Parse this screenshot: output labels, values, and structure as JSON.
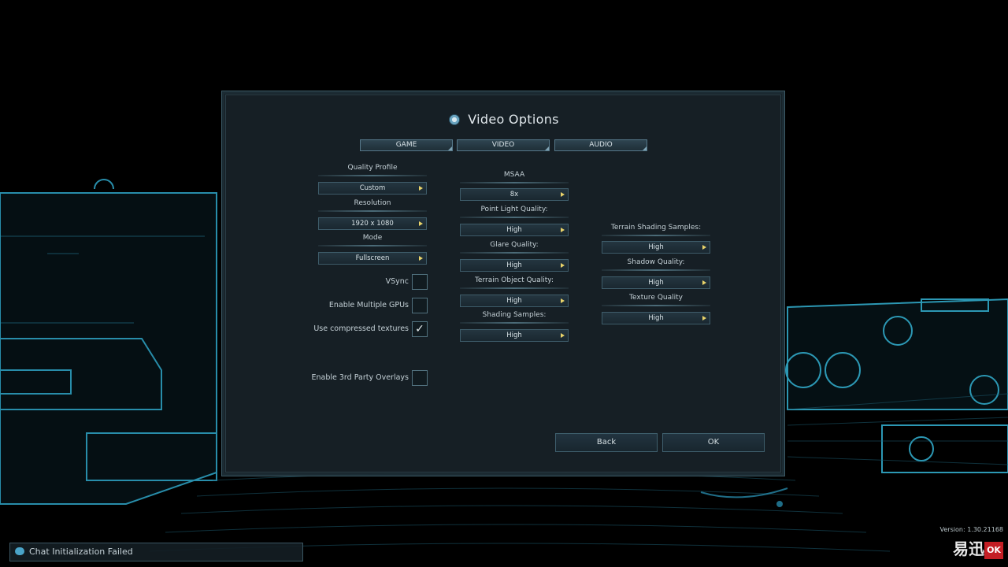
{
  "window": {
    "title": "Video Options"
  },
  "tabs": [
    {
      "label": "GAME"
    },
    {
      "label": "VIDEO"
    },
    {
      "label": "AUDIO"
    }
  ],
  "left": {
    "quality_profile": {
      "label": "Quality Profile",
      "value": "Custom"
    },
    "resolution": {
      "label": "Resolution",
      "value": "1920 x 1080"
    },
    "mode": {
      "label": "Mode",
      "value": "Fullscreen"
    },
    "vsync": {
      "label": "VSync",
      "checked": false
    },
    "multi_gpu": {
      "label": "Enable Multiple GPUs",
      "checked": false
    },
    "compressed_textures": {
      "label": "Use compressed textures",
      "checked": true,
      "mark": "✓"
    },
    "overlays": {
      "label": "Enable 3rd Party Overlays",
      "checked": false
    }
  },
  "middle": {
    "msaa": {
      "label": "MSAA",
      "value": "8x"
    },
    "point_light": {
      "label": "Point Light Quality:",
      "value": "High"
    },
    "glare": {
      "label": "Glare Quality:",
      "value": "High"
    },
    "terrain_object": {
      "label": "Terrain Object Quality:",
      "value": "High"
    },
    "shading_samples": {
      "label": "Shading Samples:",
      "value": "High"
    }
  },
  "right": {
    "terrain_shading": {
      "label": "Terrain Shading Samples:",
      "value": "High"
    },
    "shadow": {
      "label": "Shadow Quality:",
      "value": "High"
    },
    "texture": {
      "label": "Texture Quality",
      "value": "High"
    }
  },
  "buttons": {
    "back": "Back",
    "ok": "OK"
  },
  "version": "Version: 1.30.21168",
  "chat": {
    "status": "Chat Initialization Failed"
  },
  "watermark": {
    "text": "易迅",
    "logo": "OK"
  },
  "colors": {
    "accent": "#4aa4c8",
    "arrow": "#e9d36a",
    "panel": "#182228"
  }
}
